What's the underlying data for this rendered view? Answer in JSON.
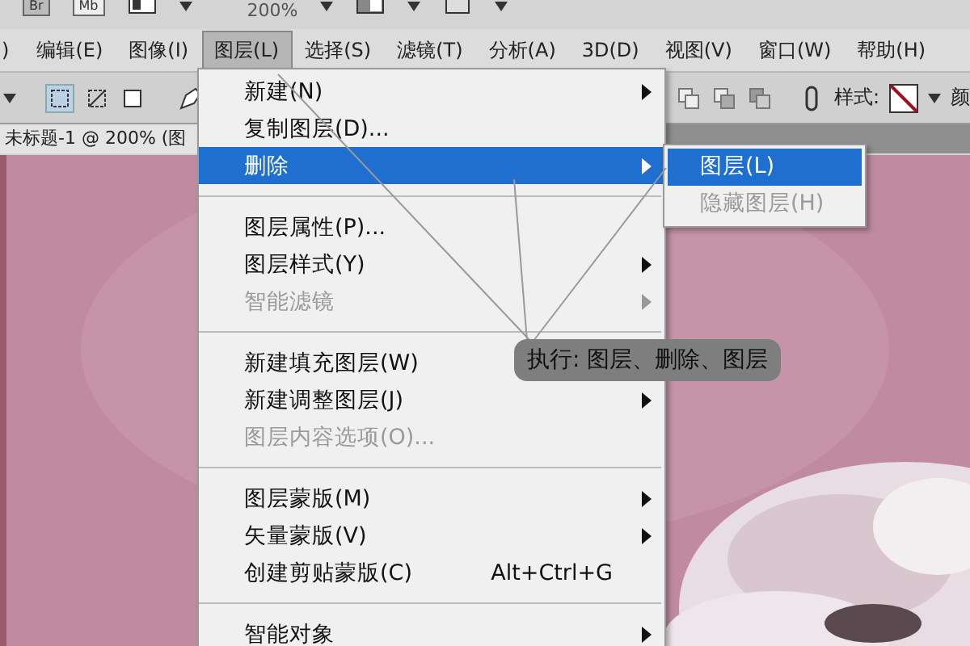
{
  "app_bar": {
    "launchers": [
      "Br",
      "Mb"
    ],
    "zoom": "200%"
  },
  "menu_bar": [
    {
      "label": ")",
      "selected": false
    },
    {
      "label": "编辑(E)",
      "selected": false
    },
    {
      "label": "图像(I)",
      "selected": false
    },
    {
      "label": "图层(L)",
      "selected": true
    },
    {
      "label": "选择(S)",
      "selected": false
    },
    {
      "label": "滤镜(T)",
      "selected": false
    },
    {
      "label": "分析(A)",
      "selected": false
    },
    {
      "label": "3D(D)",
      "selected": false
    },
    {
      "label": "视图(V)",
      "selected": false
    },
    {
      "label": "窗口(W)",
      "selected": false
    },
    {
      "label": "帮助(H)",
      "selected": false
    }
  ],
  "options_bar": {
    "style_label": "样式:",
    "cut_label": "颜"
  },
  "document_tab": {
    "title": "未标题-1 @ 200% (图"
  },
  "dropdown": [
    {
      "kind": "item",
      "label": "新建(N)",
      "submenu": true,
      "disabled": false,
      "selected": false
    },
    {
      "kind": "item",
      "label": "复制图层(D)...",
      "submenu": false,
      "disabled": false,
      "selected": false
    },
    {
      "kind": "item",
      "label": "删除",
      "submenu": true,
      "disabled": false,
      "selected": true
    },
    {
      "kind": "separator"
    },
    {
      "kind": "item",
      "label": "图层属性(P)...",
      "submenu": false,
      "disabled": false,
      "selected": false
    },
    {
      "kind": "item",
      "label": "图层样式(Y)",
      "submenu": true,
      "disabled": false,
      "selected": false
    },
    {
      "kind": "item",
      "label": "智能滤镜",
      "submenu": true,
      "disabled": true,
      "selected": false
    },
    {
      "kind": "separator"
    },
    {
      "kind": "item",
      "label": "新建填充图层(W)",
      "submenu": false,
      "disabled": false,
      "selected": false
    },
    {
      "kind": "item",
      "label": "新建调整图层(J)",
      "submenu": true,
      "disabled": false,
      "selected": false
    },
    {
      "kind": "item",
      "label": "图层内容选项(O)...",
      "submenu": false,
      "disabled": true,
      "selected": false
    },
    {
      "kind": "separator"
    },
    {
      "kind": "item",
      "label": "图层蒙版(M)",
      "submenu": true,
      "disabled": false,
      "selected": false
    },
    {
      "kind": "item",
      "label": "矢量蒙版(V)",
      "submenu": true,
      "disabled": false,
      "selected": false
    },
    {
      "kind": "item",
      "label": "创建剪贴蒙版(C)",
      "shortcut": "Alt+Ctrl+G",
      "submenu": false,
      "disabled": false,
      "selected": false
    },
    {
      "kind": "separator"
    },
    {
      "kind": "item",
      "label": "智能对象",
      "submenu": true,
      "disabled": false,
      "selected": false
    }
  ],
  "submenu": [
    {
      "label": "图层(L)",
      "disabled": false,
      "selected": true
    },
    {
      "label": "隐藏图层(H)",
      "disabled": true,
      "selected": false
    }
  ],
  "annotation": {
    "text": "执行: 图层、删除、图层"
  }
}
